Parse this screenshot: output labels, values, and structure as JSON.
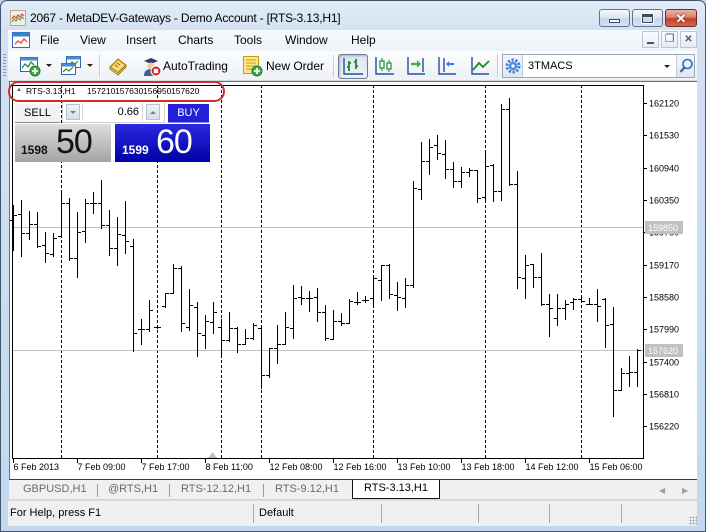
{
  "window": {
    "title": "2067 - MetaDEV-Gateways - Demo Account - [RTS-3.13,H1]",
    "app_icon": "chart-app-icon",
    "controls": [
      "minimize",
      "maximize",
      "close"
    ]
  },
  "menu": {
    "items": [
      "File",
      "View",
      "Insert",
      "Charts",
      "Tools",
      "Window",
      "Help"
    ],
    "mdi_controls": [
      "minimize",
      "restore",
      "close"
    ]
  },
  "toolbar": {
    "autotrading_label": "AutoTrading",
    "new_order_label": "New Order",
    "indicator_combo_value": "3TMACS",
    "active_chart_mode": "bar-chart"
  },
  "chart_header": {
    "symbol": "RTS-3.13,H1",
    "open": "157210",
    "high": "157630",
    "low": "156950",
    "close": "157620"
  },
  "one_click": {
    "sell_label": "SELL",
    "buy_label": "BUY",
    "lot_value": "0.66",
    "sell_price_prefix": "1598",
    "sell_price_suffix": "50",
    "buy_price_prefix": "1599",
    "buy_price_suffix": "60"
  },
  "tabs": [
    {
      "label": "GBPUSD,H1",
      "active": false
    },
    {
      "label": "@RTS,H1",
      "active": false
    },
    {
      "label": "RTS-12.12,H1",
      "active": false
    },
    {
      "label": "RTS-9.12,H1",
      "active": false
    },
    {
      "label": "RTS-3.13,H1",
      "active": true
    }
  ],
  "status": {
    "help_text": "For Help, press F1",
    "profile": "Default"
  },
  "colors": {
    "buy": "#0000c0",
    "sell": "#a8a8a8",
    "annotation": "#d42a2a",
    "price_line": "#c0c0c0",
    "bars": "#000000"
  },
  "chart_data": {
    "type": "bar",
    "bar_style": "ohlc",
    "title": "RTS-3.13,H1",
    "timeframe": "H1",
    "xlabel": "",
    "ylabel": "",
    "ylim": [
      155641,
      162449
    ],
    "grid": false,
    "y_ticks": [
      162120,
      161530,
      160940,
      160350,
      159760,
      159170,
      158580,
      157990,
      157400,
      156810,
      156220
    ],
    "x_ticks": [
      {
        "bar": 0,
        "label": "6 Feb 2013"
      },
      {
        "bar": 8,
        "label": "7 Feb 09:00"
      },
      {
        "bar": 16,
        "label": "7 Feb 17:00"
      },
      {
        "bar": 24,
        "label": "8 Feb 11:00"
      },
      {
        "bar": 32,
        "label": "12 Feb 08:00"
      },
      {
        "bar": 40,
        "label": "12 Feb 16:00"
      },
      {
        "bar": 48,
        "label": "13 Feb 10:00"
      },
      {
        "bar": 56,
        "label": "13 Feb 18:00"
      },
      {
        "bar": 64,
        "label": "14 Feb 12:00"
      },
      {
        "bar": 72,
        "label": "15 Feb 06:00"
      }
    ],
    "period_separators_at_bar": [
      6,
      18,
      26,
      31,
      45,
      59,
      71
    ],
    "price_lines": [
      {
        "name": "bid",
        "value": 159850,
        "label": "159850"
      },
      {
        "name": "last",
        "value": 157620,
        "label": "157620"
      }
    ],
    "ohlc_fields": [
      "open",
      "high",
      "low",
      "close"
    ],
    "bars": [
      [
        159990,
        160260,
        159440,
        160080
      ],
      [
        160090,
        160350,
        159320,
        159750
      ],
      [
        159750,
        160150,
        159640,
        159910
      ],
      [
        159910,
        160140,
        159500,
        159510
      ],
      [
        159520,
        159770,
        159220,
        159380
      ],
      [
        159360,
        159750,
        159330,
        159660
      ],
      [
        159700,
        160470,
        159680,
        160300
      ],
      [
        160300,
        160380,
        159260,
        159290
      ],
      [
        159290,
        160140,
        158940,
        159770
      ],
      [
        159780,
        160360,
        159590,
        160290
      ],
      [
        160300,
        160490,
        160110,
        160300
      ],
      [
        160290,
        160710,
        159830,
        159890
      ],
      [
        159890,
        160170,
        159350,
        159470
      ],
      [
        159470,
        160040,
        159160,
        159730
      ],
      [
        159710,
        160330,
        159390,
        159600
      ],
      [
        159510,
        159640,
        157600,
        157930
      ],
      [
        157990,
        158180,
        157730,
        157990
      ],
      [
        157990,
        158520,
        157960,
        158350
      ],
      [
        158040,
        158070,
        158010,
        158030
      ],
      [
        158420,
        158650,
        158400,
        158650
      ],
      [
        158650,
        159190,
        158650,
        159100
      ],
      [
        159100,
        159150,
        157950,
        158100
      ],
      [
        158040,
        158730,
        157980,
        158430
      ],
      [
        158400,
        158490,
        157510,
        157920
      ],
      [
        157890,
        158250,
        157650,
        158140
      ],
      [
        158130,
        158490,
        157930,
        158310
      ],
      [
        158030,
        158170,
        157480,
        157800
      ],
      [
        157800,
        158310,
        157780,
        158010
      ],
      [
        158010,
        158030,
        157570,
        157730
      ],
      [
        157730,
        158000,
        157720,
        157830
      ],
      [
        157830,
        158100,
        157820,
        158060
      ],
      [
        158010,
        158030,
        156920,
        157150
      ],
      [
        157150,
        157650,
        157120,
        157640
      ],
      [
        157640,
        158070,
        157370,
        157720
      ],
      [
        157720,
        158310,
        157720,
        158030
      ],
      [
        158010,
        158800,
        157830,
        158570
      ],
      [
        158580,
        158780,
        158460,
        158570
      ],
      [
        158560,
        158690,
        158330,
        158570
      ],
      [
        158580,
        158740,
        158150,
        158300
      ],
      [
        158300,
        158430,
        157800,
        157840
      ],
      [
        157810,
        158350,
        157810,
        158140
      ],
      [
        158150,
        158290,
        158060,
        158100
      ],
      [
        158110,
        158540,
        158100,
        158510
      ],
      [
        158490,
        158670,
        158460,
        158490
      ],
      [
        158520,
        158600,
        158480,
        158520
      ],
      [
        158570,
        158950,
        158430,
        158920
      ],
      [
        158890,
        159160,
        158520,
        159160
      ],
      [
        159160,
        159180,
        158560,
        158630
      ],
      [
        158620,
        158850,
        158350,
        158580
      ],
      [
        158570,
        158930,
        158400,
        158800
      ],
      [
        158790,
        160700,
        158760,
        160560
      ],
      [
        160550,
        161400,
        160360,
        161070
      ],
      [
        161070,
        161460,
        160820,
        161320
      ],
      [
        161350,
        161540,
        161090,
        161200
      ],
      [
        161190,
        161440,
        160760,
        160910
      ],
      [
        160910,
        161050,
        160590,
        160700
      ],
      [
        160700,
        160950,
        160580,
        160860
      ],
      [
        160860,
        160930,
        160790,
        160900
      ],
      [
        160900,
        160900,
        160320,
        160380
      ],
      [
        160400,
        161240,
        160350,
        160970
      ],
      [
        160990,
        161000,
        160340,
        160510
      ],
      [
        160510,
        162100,
        160350,
        162020
      ],
      [
        162020,
        162220,
        160620,
        160650
      ],
      [
        160650,
        160880,
        158740,
        158940
      ],
      [
        158920,
        159350,
        158570,
        159160
      ],
      [
        159180,
        159190,
        158770,
        158950
      ],
      [
        158940,
        159380,
        158430,
        158450
      ],
      [
        158450,
        158630,
        157860,
        158370
      ],
      [
        158200,
        158630,
        158060,
        158370
      ],
      [
        158370,
        158520,
        158180,
        158450
      ],
      [
        158480,
        158570,
        158360,
        158540
      ],
      [
        158540,
        158570,
        158480,
        158510
      ],
      [
        158460,
        158570,
        158450,
        158460
      ],
      [
        158450,
        158730,
        158150,
        158420
      ],
      [
        158540,
        158560,
        157670,
        158070
      ],
      [
        158080,
        158390,
        156410,
        156880
      ],
      [
        156880,
        157280,
        156880,
        157190
      ],
      [
        157200,
        157500,
        156960,
        157210
      ],
      [
        157210,
        157630,
        156950,
        157620
      ]
    ]
  }
}
